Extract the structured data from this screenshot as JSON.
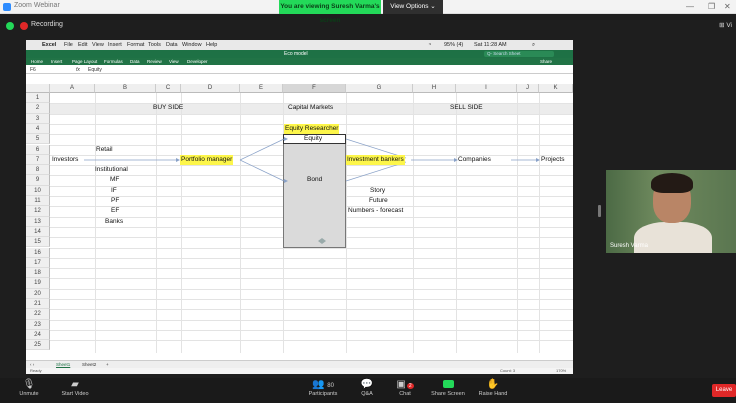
{
  "zoom": {
    "app_title": "Zoom Webinar",
    "viewing_banner": "You are viewing Suresh Varma's screen",
    "view_options": "View Options ⌄",
    "recording": "Recording",
    "view_button": "Vi"
  },
  "mac": {
    "menu": [
      "Excel",
      "File",
      "Edit",
      "View",
      "Insert",
      "Format",
      "Tools",
      "Data",
      "Window",
      "Help"
    ],
    "status_right": "Sat 11:28 AM",
    "battery": "95% (4)"
  },
  "excel": {
    "filename": "Eco model",
    "search_placeholder": "Q- Search Sheet",
    "ribbon_tabs": [
      "Home",
      "Insert",
      "Page Layout",
      "Formulas",
      "Data",
      "Review",
      "View",
      "Developer"
    ],
    "share": "Share",
    "cell_ref": "F6",
    "formula": "Equity",
    "columns": [
      "A",
      "B",
      "C",
      "D",
      "E",
      "F",
      "G",
      "H",
      "I",
      "J",
      "K"
    ],
    "rows": [
      "1",
      "2",
      "3",
      "4",
      "5",
      "6",
      "7",
      "8",
      "9",
      "10",
      "11",
      "12",
      "13",
      "14",
      "15",
      "16",
      "17",
      "18",
      "19",
      "20",
      "21",
      "22",
      "23",
      "24",
      "25"
    ],
    "cells": {
      "buy_side": "BUY SIDE",
      "capital_markets": "Capital Markets",
      "sell_side": "SELL SIDE",
      "equity_researcher": "Equity Researcher",
      "equity": "Equity",
      "retail": "Retail",
      "investors": "Investors",
      "portfolio_manager": "Portfolio manager",
      "investment_bankers": "Investment bankers",
      "companies": "Companies",
      "projects": "Projects",
      "institutional": "Institutional",
      "mf": "MF",
      "bond": "Bond",
      "if": "IF",
      "story": "Story",
      "pf": "PF",
      "future": "Future",
      "ef": "EF",
      "numbers_forecast": "Numbers - forecast",
      "banks": "Banks"
    },
    "sheets": [
      "Sheet1",
      "Sheet2"
    ],
    "ready": "Ready",
    "count": "Count: 3",
    "zoom_level": "170%"
  },
  "video": {
    "participant_name": "Suresh Varma"
  },
  "toolbar": {
    "unmute": "Unmute",
    "start_video": "Start Video",
    "participants": "Participants",
    "participants_count": "80",
    "qa": "Q&A",
    "chat": "Chat",
    "chat_badge": "2",
    "share_screen": "Share Screen",
    "raise_hand": "Raise Hand",
    "leave": "Leave"
  }
}
